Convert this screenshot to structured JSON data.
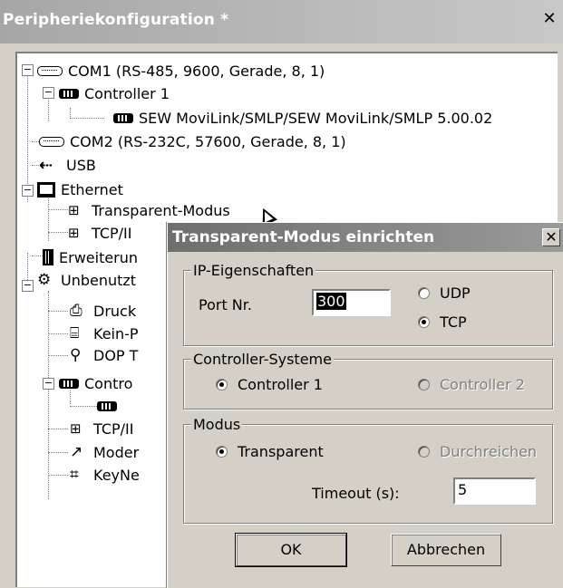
{
  "window": {
    "title": "Peripheriekonfiguration *",
    "close_glyph": "✕"
  },
  "tree": {
    "items": [
      {
        "label": "COM1 (RS-485, 9600, Gerade, 8, 1)",
        "icon": "serial-port-icon"
      },
      {
        "label": "Controller 1",
        "icon": "controller-icon"
      },
      {
        "label": "SEW MoviLink/SMLP/SEW MoviLink/SMLP 5.00.02",
        "icon": "controller-icon"
      },
      {
        "label": "COM2 (RS-232C, 57600, Gerade, 8, 1)",
        "icon": "serial-port-icon"
      },
      {
        "label": "USB",
        "icon": "usb-icon"
      },
      {
        "label": "Ethernet",
        "icon": "ethernet-icon"
      },
      {
        "label": "Transparent-Modus",
        "icon": "network-icon"
      },
      {
        "label": "TCP/II",
        "icon": "network-icon"
      },
      {
        "label": "Erweiterun",
        "icon": "expansion-icon"
      },
      {
        "label": "Unbenutzt",
        "icon": "unused-icon"
      },
      {
        "label": "Druck",
        "icon": "printer-icon"
      },
      {
        "label": "Kein-P",
        "icon": "no-printer-icon"
      },
      {
        "label": "DOP T",
        "icon": "tool-icon"
      },
      {
        "label": "Contro",
        "icon": "controller-icon"
      },
      {
        "label": "",
        "icon": "controller-icon"
      },
      {
        "label": "TCP/II",
        "icon": "network-icon"
      },
      {
        "label": "Moder",
        "icon": "modem-icon"
      },
      {
        "label": "KeyNe",
        "icon": "keynet-icon"
      }
    ],
    "expanders": [
      "−",
      "−",
      "−",
      "−",
      "−"
    ]
  },
  "dialog": {
    "title": "Transparent-Modus einrichten",
    "close_glyph": "✕",
    "ip_group": {
      "legend": "IP-Eigenschaften",
      "port_label": "Port Nr.",
      "port_value": "300",
      "udp_label": "UDP",
      "tcp_label": "TCP",
      "selected": "TCP"
    },
    "controller_group": {
      "legend": "Controller-Systeme",
      "controller1_label": "Controller 1",
      "controller2_label": "Controller 2",
      "selected": "Controller 1"
    },
    "mode_group": {
      "legend": "Modus",
      "transparent_label": "Transparent",
      "passthrough_label": "Durchreichen",
      "selected": "Transparent",
      "timeout_label": "Timeout (s):",
      "timeout_value": "5"
    },
    "ok_label": "OK",
    "cancel_label": "Abbrechen"
  }
}
